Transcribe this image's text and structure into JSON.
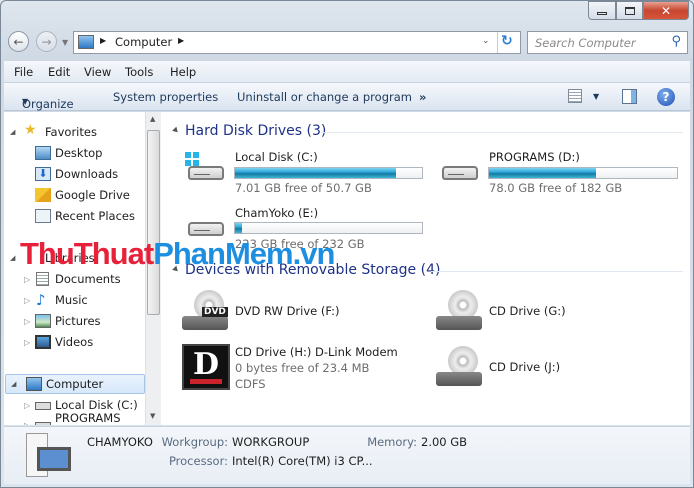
{
  "window": {
    "title": "Computer",
    "buttons": {
      "minimize": "minimize",
      "maximize": "maximize",
      "close": "close"
    }
  },
  "address": {
    "location": "Computer",
    "search_placeholder": "Search Computer"
  },
  "menu": [
    "File",
    "Edit",
    "View",
    "Tools",
    "Help"
  ],
  "toolbar": {
    "organize": "Organize",
    "system_properties": "System properties",
    "uninstall": "Uninstall or change a program",
    "more": "»"
  },
  "nav": {
    "favorites": "Favorites",
    "favorites_items": [
      "Desktop",
      "Downloads",
      "Google Drive",
      "Recent Places"
    ],
    "libraries": "Libraries",
    "libraries_items": [
      "Documents",
      "Music",
      "Pictures",
      "Videos"
    ],
    "computer": "Computer",
    "computer_items": [
      "Local Disk (C:)",
      "PROGRAMS (D:)"
    ]
  },
  "hard_disks": {
    "header": "Hard Disk Drives (3)",
    "drives": [
      {
        "name": "Local Disk (C:)",
        "free": "7.01 GB free of 50.7 GB",
        "used_percent": 86
      },
      {
        "name": "PROGRAMS (D:)",
        "free": "78.0 GB free of 182 GB",
        "used_percent": 57
      },
      {
        "name": "ChamYoko (E:)",
        "free": "223 GB free of 232 GB",
        "used_percent": 4
      }
    ]
  },
  "removable": {
    "header": "Devices with Removable Storage (4)",
    "devices": [
      {
        "name": "DVD RW Drive (F:)"
      },
      {
        "name": "CD Drive (G:)"
      },
      {
        "name": "CD Drive (H:) D-Link Modem",
        "free": "0 bytes free of 23.4 MB",
        "fs": "CDFS",
        "badge": "D"
      },
      {
        "name": "CD Drive (J:)"
      }
    ]
  },
  "details": {
    "computer_name": "CHAMYOKO",
    "workgroup_label": "Workgroup:",
    "workgroup": "WORKGROUP",
    "memory_label": "Memory:",
    "memory": "2.00 GB",
    "processor_label": "Processor:",
    "processor": "Intel(R) Core(TM) i3 CP..."
  },
  "watermark": {
    "part1": "ThuThuat",
    "part2": "PhanMem",
    "part3": ".vn",
    "color1": "#e8213a",
    "color2": "#1e8fe0"
  },
  "dvd_label": "DVD"
}
